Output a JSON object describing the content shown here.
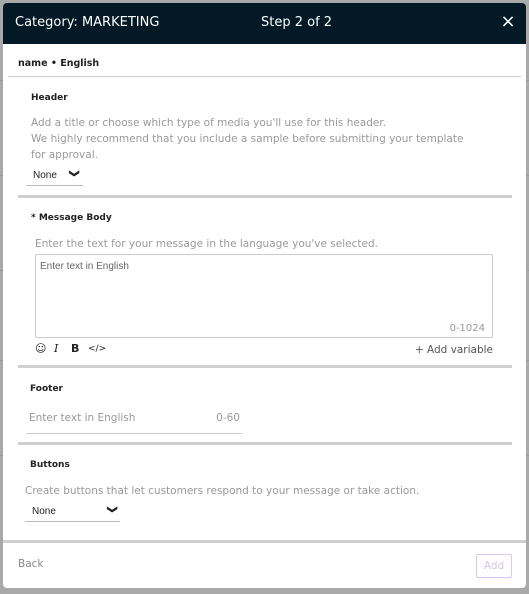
{
  "modal": {
    "title": "Category: MARKETING",
    "step": "Step 2 of 2",
    "close_icon": "×",
    "subtitle": "name • English"
  },
  "header_section": {
    "label": "Header",
    "help_line1": "Add a title or choose which type of media you'll use for this header.",
    "help_line2": "We highly recommend that you include a sample before submitting your template",
    "help_line3": "for approval.",
    "select_value": "None",
    "chevron_icon": "❯"
  },
  "body_section": {
    "label": "* Message Body",
    "help": "Enter the text for your message in the language you've selected.",
    "placeholder": "Enter text in English",
    "char_count": "0-1024",
    "toolbar": {
      "emoji_icon": "☺",
      "italic_icon": "I",
      "bold_icon": "B",
      "code_icon": "</>"
    },
    "add_variable": "+ Add variable"
  },
  "footer_section": {
    "label": "Footer",
    "placeholder": "Enter text in English",
    "char_count": "0-60"
  },
  "buttons_section": {
    "label": "Buttons",
    "help": "Create buttons that let customers respond to your message or take action.",
    "select_value": "None"
  },
  "actions": {
    "back": "Back",
    "add": "Add"
  }
}
